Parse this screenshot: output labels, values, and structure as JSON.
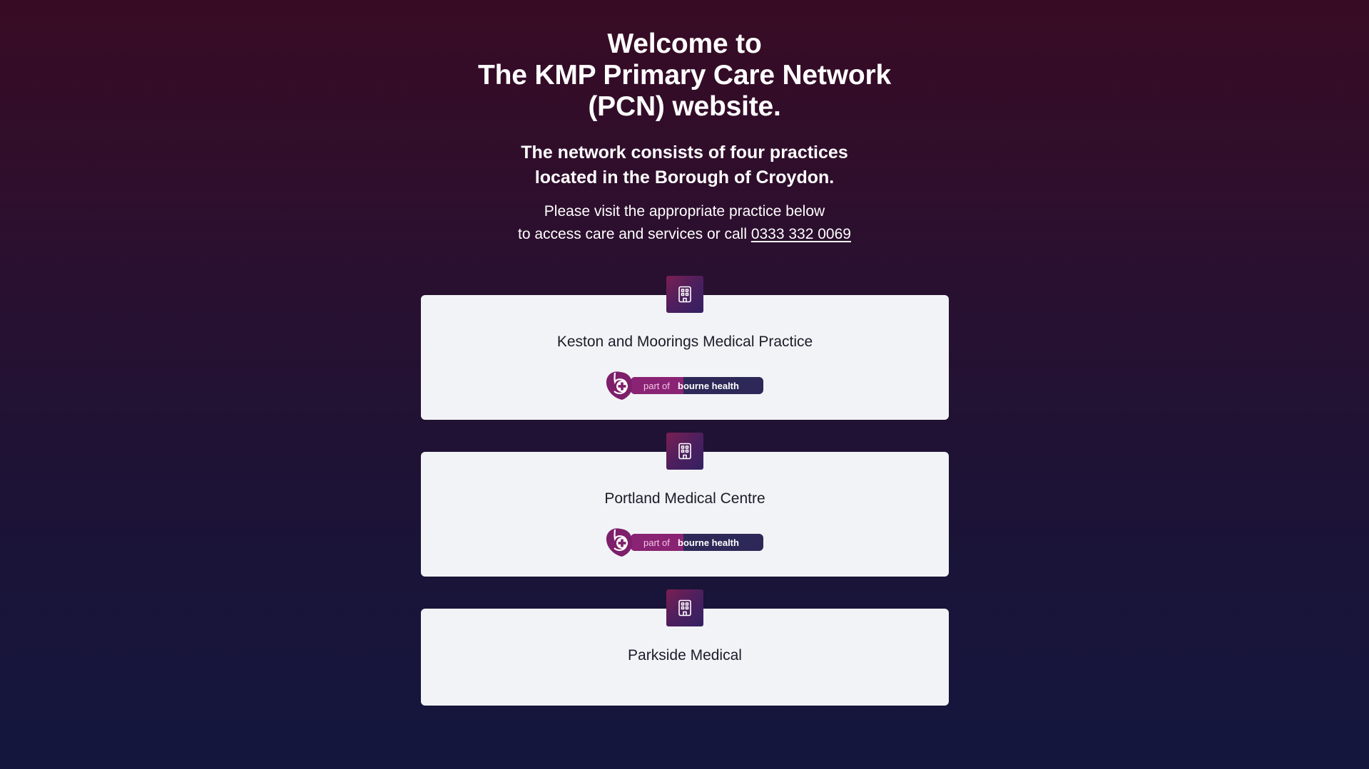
{
  "hero": {
    "title_lines": [
      "Welcome to",
      "The KMP Primary Care Network",
      "(PCN) website."
    ],
    "subtitle_lines": [
      "The network consists of four practices",
      "located in the Borough of Croydon."
    ],
    "intro_line1": "Please visit the appropriate practice below",
    "intro_line2_prefix": "to access care and services or call ",
    "phone": "0333 332 0069"
  },
  "practices": [
    {
      "name": "Keston and Moorings Medical Practice",
      "icon": "building-icon",
      "badge": {
        "prefix": "part of",
        "brand": "bourne health"
      }
    },
    {
      "name": "Portland Medical Centre",
      "icon": "building-icon",
      "badge": {
        "prefix": "part of",
        "brand": "bourne health"
      }
    },
    {
      "name": "Parkside Medical",
      "icon": "building-icon"
    }
  ],
  "colors": {
    "background_top": "#380b24",
    "background_bottom": "#14163e",
    "card": "#f2f3f6",
    "icon_tile": "#5a1f5c",
    "badge_magenta": "#8a2374",
    "badge_navy": "#2c2857"
  }
}
